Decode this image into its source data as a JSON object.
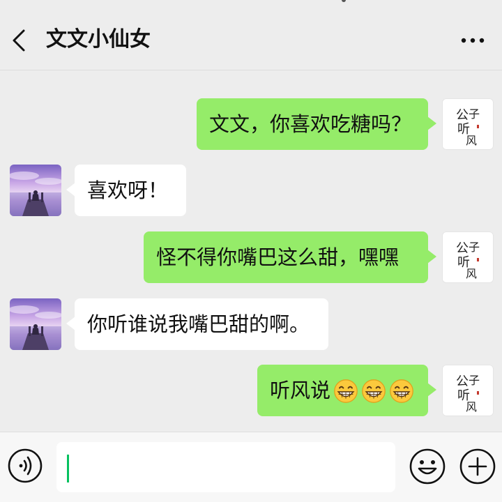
{
  "header": {
    "title": "文文小仙女",
    "back_icon": "chevron-left-icon",
    "more_icon": "more-dots-icon"
  },
  "messages": [
    {
      "sender": "me",
      "text": "文文，你喜欢吃糖吗？"
    },
    {
      "sender": "them",
      "text": "喜欢呀！"
    },
    {
      "sender": "me",
      "text": "怪不得你嘴巴这么甜，嘿嘿"
    },
    {
      "sender": "them",
      "text": "你听谁说我嘴巴甜的啊。"
    },
    {
      "sender": "me",
      "text": "听风说",
      "emoji": [
        "grinning-face",
        "grinning-face",
        "grinning-face"
      ]
    }
  ],
  "self_avatar_text": "公子听风",
  "input": {
    "value": "",
    "voice_icon": "voice-icon",
    "emoji_icon": "smiley-icon",
    "plus_icon": "plus-icon"
  },
  "colors": {
    "background": "#ededed",
    "my_bubble": "#95ec69",
    "their_bubble": "#ffffff",
    "caret": "#07c160"
  }
}
